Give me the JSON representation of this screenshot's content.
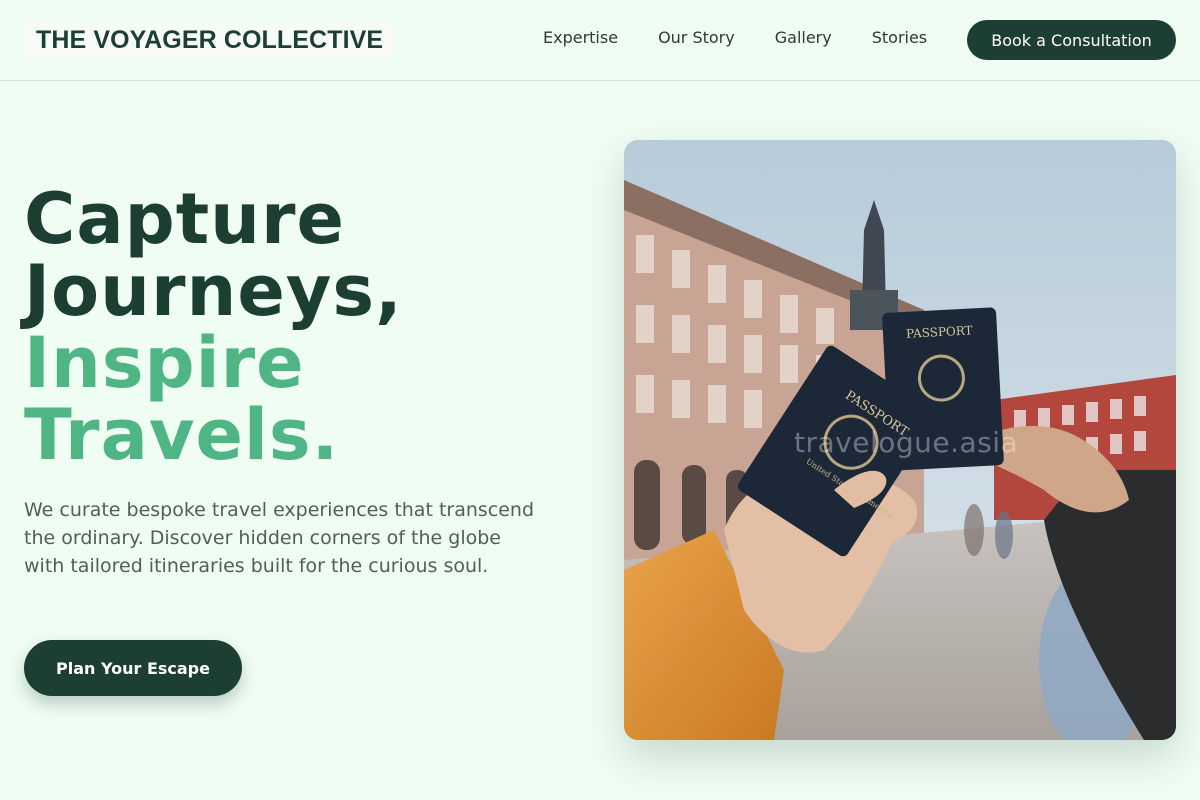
{
  "brand": {
    "name": "THE VOYAGER COLLECTIVE"
  },
  "nav": {
    "items": [
      {
        "label": "Expertise"
      },
      {
        "label": "Our Story"
      },
      {
        "label": "Gallery"
      },
      {
        "label": "Stories"
      }
    ],
    "cta_label": "Book a Consultation"
  },
  "hero": {
    "headline_dark_1": "Capture",
    "headline_dark_2": "Journeys,",
    "headline_light_1": "Inspire",
    "headline_light_2": "Travels.",
    "description": "We curate bespoke travel experiences that transcend the ordinary. Discover hidden corners of the globe with tailored itineraries built for the curious soul.",
    "cta_label": "Plan Your Escape",
    "image": {
      "passport_label": "PASSPORT",
      "passport_sub": "United States of America",
      "watermark": "travelogue.asia"
    }
  },
  "colors": {
    "background": "#effdf3",
    "primary": "#1d3f33",
    "accent": "#4fb584",
    "body_text": "#4e6158"
  }
}
